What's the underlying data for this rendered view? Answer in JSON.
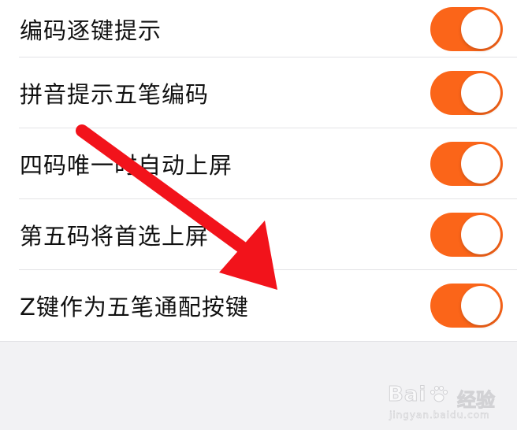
{
  "settings": {
    "rows": [
      {
        "label": "编码逐键提示",
        "enabled": true
      },
      {
        "label": "拼音提示五笔编码",
        "enabled": true
      },
      {
        "label": "四码唯一时自动上屏",
        "enabled": true
      },
      {
        "label": "第五码将首选上屏",
        "enabled": true
      },
      {
        "label": "Z键作为五笔通配按键",
        "enabled": true
      }
    ]
  },
  "colors": {
    "toggle_on": "#fb6519",
    "arrow": "#f2131b",
    "background": "#f2f2f4",
    "list_background": "#ffffff"
  },
  "watermark": {
    "brand": "Bai",
    "brand_suffix": "经验",
    "url": "jingyan.baidu.com",
    "icon": "paw-icon"
  },
  "annotation": {
    "icon": "red-arrow-icon"
  }
}
